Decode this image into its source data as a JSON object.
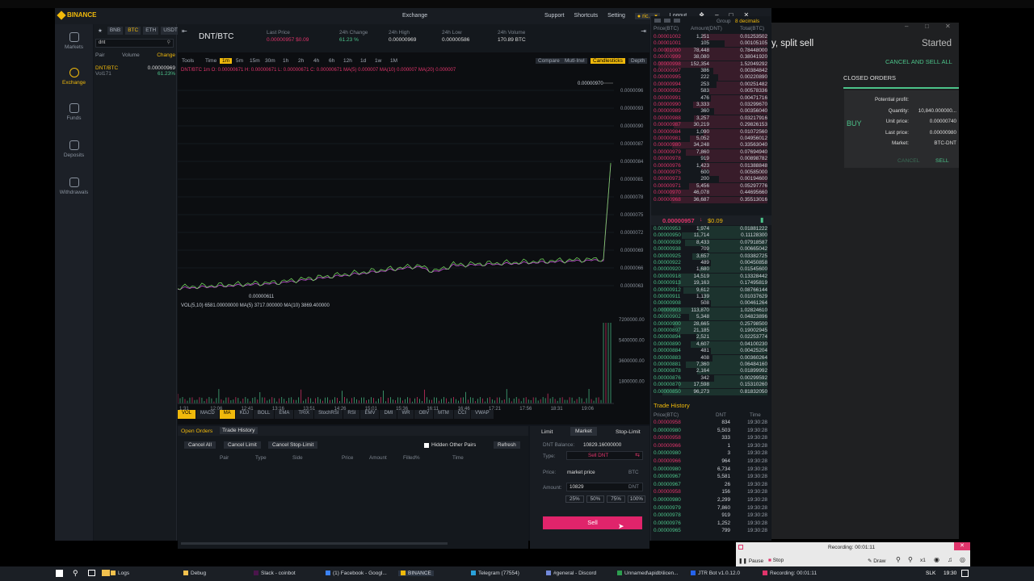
{
  "window": {
    "app_name": "BINANCE",
    "title": "Exchange",
    "nav": [
      "Support",
      "Shortcuts",
      "Setting",
      "ric...",
      "Logout"
    ]
  },
  "sidebar": {
    "items": [
      {
        "label": "Markets",
        "icon": "chart-icon"
      },
      {
        "label": "Exchange",
        "icon": "exchange-icon"
      },
      {
        "label": "Funds",
        "icon": "wallet-icon"
      },
      {
        "label": "Deposits",
        "icon": "download-icon"
      },
      {
        "label": "Withdrawals",
        "icon": "upload-icon"
      }
    ]
  },
  "market_list": {
    "tabs": [
      "BNB",
      "BTC",
      "ETH",
      "USDT"
    ],
    "search_value": "dnt",
    "columns": [
      "Pair",
      "Volume",
      "Change"
    ],
    "row": {
      "pair": "DNT/BTC",
      "vol": "Vol171",
      "price": "0.00000969",
      "change": "61.23%"
    }
  },
  "ticker": {
    "pair": "DNT/BTC",
    "last_price_label": "Last Price",
    "last_price": "0.00000957 $0.09",
    "change_label": "24h Change",
    "change": "61.23 %",
    "high_label": "24h High",
    "high": "0.00000969",
    "low_label": "24h Low",
    "low": "0.00000586",
    "volume_label": "24h Volume",
    "volume": "170.89 BTC"
  },
  "chart_toolbar": {
    "left": [
      "Tools",
      "Time",
      "1m",
      "5m",
      "15m",
      "30m",
      "1h",
      "2h",
      "4h",
      "6h",
      "12h",
      "1d",
      "1w",
      "1M"
    ],
    "right": [
      "Compare",
      "Mutl-Invl",
      "Candlesticks",
      "Depth"
    ],
    "ohlc_text": "DNT/BTC 1m  O: 0.00000671  H: 0.00000671  L: 0.00000671  C: 0.00000671  MA(5) 0.000007  MA(10) 0.000007  MA(20) 0.000007",
    "vol_text": "VOL(5,10)  6581.00000000  MA(5) 3717.000000  MA(10) 3869.400000",
    "max_label": "0.00000970",
    "min_label": "0.00000611",
    "price_axis": [
      "0.0000096",
      "0.0000093",
      "0.0000090",
      "0.0000087",
      "0.0000084",
      "0.0000081",
      "0.0000078",
      "0.0000075",
      "0.0000072",
      "0.0000069",
      "0.0000066",
      "0.0000063"
    ],
    "vol_axis": [
      "7200000.00",
      "5400000.00",
      "3600000.00",
      "1800000.00"
    ],
    "time_axis": [
      "1:31",
      "12:06",
      "12:41",
      "13:16",
      "13:51",
      "14:26",
      "15:01",
      "15:36",
      "16:11",
      "16:46",
      "17:21",
      "17:56",
      "18:31",
      "19:06"
    ],
    "indicators": [
      "VOL",
      "MACD",
      "MA",
      "KDJ",
      "BOLL",
      "EMA",
      "TRIX",
      "StochRSI",
      "RSI",
      "EMV",
      "DMI",
      "WR",
      "OBV",
      "MTM",
      "CCI",
      "VWAP"
    ]
  },
  "orders": {
    "tabs": [
      "Open Orders",
      "Trade History"
    ],
    "buttons": [
      "Cancel All",
      "Cancel Limit",
      "Cancel Stop-Limit"
    ],
    "hidden_label": "Hidden Other Pairs",
    "refresh": "Refresh",
    "columns": [
      "Pair",
      "Type",
      "Side",
      "Price",
      "Amount",
      "Filled%",
      "Time"
    ]
  },
  "trade_form": {
    "tabs": [
      "Limit",
      "Market",
      "Stop-Limit"
    ],
    "balance_label": "DNT Balance:",
    "balance": "10829.16000000",
    "type_label": "Type:",
    "type_value": "Sell DNT",
    "price_label": "Price:",
    "price_value": "market price",
    "price_unit": "BTC",
    "amount_label": "Amount:",
    "amount_value": "10829",
    "amount_unit": "DNT",
    "pct": [
      "25%",
      "50%",
      "75%",
      "100%"
    ],
    "sell": "Sell"
  },
  "order_book": {
    "group_label": "Group",
    "decimals": "8 decimals",
    "cols": [
      "Price(BTC)",
      "Amount(DNT)",
      "Total(BTC)"
    ],
    "asks": [
      [
        "0.00001002",
        "1,251",
        "0.01253502"
      ],
      [
        "0.00001001",
        "105",
        "0.00105105"
      ],
      [
        "0.00001000",
        "78,448",
        "0.78448000"
      ],
      [
        "0.00000999",
        "38,080",
        "0.38041920"
      ],
      [
        "0.00000998",
        "152,354",
        "1.52049292"
      ],
      [
        "0.00000997",
        "386",
        "0.00384842"
      ],
      [
        "0.00000995",
        "222",
        "0.00220890"
      ],
      [
        "0.00000994",
        "253",
        "0.00251482"
      ],
      [
        "0.00000992",
        "583",
        "0.00578336"
      ],
      [
        "0.00000991",
        "476",
        "0.00471716"
      ],
      [
        "0.00000990",
        "3,333",
        "0.03299670"
      ],
      [
        "0.00000989",
        "360",
        "0.00356040"
      ],
      [
        "0.00000988",
        "3,257",
        "0.03217916"
      ],
      [
        "0.00000987",
        "30,219",
        "0.29826153"
      ],
      [
        "0.00000984",
        "1,090",
        "0.01072560"
      ],
      [
        "0.00000981",
        "5,052",
        "0.04956012"
      ],
      [
        "0.00000980",
        "34,248",
        "0.33563040"
      ],
      [
        "0.00000979",
        "7,860",
        "0.07694940"
      ],
      [
        "0.00000978",
        "919",
        "0.00898782"
      ],
      [
        "0.00000976",
        "1,423",
        "0.01388848"
      ],
      [
        "0.00000975",
        "600",
        "0.00585000"
      ],
      [
        "0.00000973",
        "200",
        "0.00194600"
      ],
      [
        "0.00000971",
        "5,456",
        "0.05297776"
      ],
      [
        "0.00000970",
        "46,078",
        "0.44695660"
      ],
      [
        "0.00000968",
        "36,687",
        "0.35513016"
      ]
    ],
    "last": "0.00000957",
    "last_usd": "$0.09",
    "bids": [
      [
        "0.00000953",
        "1,974",
        "0.01881222"
      ],
      [
        "0.00000950",
        "11,714",
        "0.11128300"
      ],
      [
        "0.00000939",
        "8,433",
        "0.07918587"
      ],
      [
        "0.00000938",
        "709",
        "0.00665042"
      ],
      [
        "0.00000925",
        "3,657",
        "0.03382725"
      ],
      [
        "0.00000922",
        "489",
        "0.00450858"
      ],
      [
        "0.00000920",
        "1,680",
        "0.01545600"
      ],
      [
        "0.00000918",
        "14,519",
        "0.13328442"
      ],
      [
        "0.00000913",
        "19,163",
        "0.17495819"
      ],
      [
        "0.00000912",
        "9,612",
        "0.08766144"
      ],
      [
        "0.00000911",
        "1,139",
        "0.01037629"
      ],
      [
        "0.00000908",
        "508",
        "0.00461264"
      ],
      [
        "0.00000903",
        "113,870",
        "1.02824610"
      ],
      [
        "0.00000902",
        "5,348",
        "0.04823896"
      ],
      [
        "0.00000900",
        "28,665",
        "0.25798500"
      ],
      [
        "0.00000897",
        "21,185",
        "0.19002945"
      ],
      [
        "0.00000894",
        "2,521",
        "0.02253774"
      ],
      [
        "0.00000890",
        "4,607",
        "0.04100230"
      ],
      [
        "0.00000884",
        "481",
        "0.00425204"
      ],
      [
        "0.00000883",
        "408",
        "0.00360264"
      ],
      [
        "0.00000881",
        "7,360",
        "0.06484160"
      ],
      [
        "0.00000878",
        "2,164",
        "0.01899992"
      ],
      [
        "0.00000876",
        "342",
        "0.00299592"
      ],
      [
        "0.00000870",
        "17,598",
        "0.15310260"
      ],
      [
        "0.00000850",
        "96,273",
        "0.81832050"
      ]
    ]
  },
  "trade_history": {
    "title": "Trade History",
    "cols": [
      "Price(BTC)",
      "DNT",
      "Time"
    ],
    "rows": [
      [
        "0.00000958",
        "834",
        "19:30:28",
        "s"
      ],
      [
        "0.00000980",
        "5,503",
        "19:30:28",
        "b"
      ],
      [
        "0.00000958",
        "333",
        "19:30:28",
        "s"
      ],
      [
        "0.00000966",
        "1",
        "19:30:28",
        "s"
      ],
      [
        "0.00000980",
        "3",
        "19:30:28",
        "b"
      ],
      [
        "0.00000966",
        "964",
        "19:30:28",
        "s"
      ],
      [
        "0.00000980",
        "6,734",
        "19:30:28",
        "b"
      ],
      [
        "0.00000967",
        "5,581",
        "19:30:28",
        "b"
      ],
      [
        "0.00000967",
        "26",
        "19:30:28",
        "b"
      ],
      [
        "0.00000958",
        "156",
        "19:30:28",
        "s"
      ],
      [
        "0.00000980",
        "2,299",
        "19:30:28",
        "b"
      ],
      [
        "0.00000979",
        "7,860",
        "19:30:28",
        "b"
      ],
      [
        "0.00000978",
        "919",
        "19:30:28",
        "b"
      ],
      [
        "0.00000976",
        "1,252",
        "19:30:28",
        "b"
      ],
      [
        "0.00000965",
        "799",
        "19:30:28",
        "b"
      ]
    ]
  },
  "right_app": {
    "heading": "y, split sell",
    "status": "Started",
    "cancel_sell": "CANCEL AND SELL ALL",
    "closed_orders": "CLOSED ORDERS",
    "buy": "BUY",
    "fields": [
      {
        "label": "Potential profit:",
        "value": ""
      },
      {
        "label": "Quantity:",
        "value": "10,840.000000..."
      },
      {
        "label": "Unit price:",
        "value": "0.00000740"
      },
      {
        "label": "Last price:",
        "value": "0.00000980"
      },
      {
        "label": "Market:",
        "value": "BTC-DNT"
      }
    ],
    "cancel": "CANCEL",
    "sell": "SELL"
  },
  "recorder": {
    "title": "Recording: 00:01:11",
    "pause": "Pause",
    "stop": "Stop",
    "draw": "Draw",
    "zoom": "x1"
  },
  "taskbar": {
    "items": [
      "Logs",
      "Debug",
      "Slack - coinbot",
      "(1) Facebook - Googl...",
      "BINANCE",
      "Telegram (77554)",
      "#general - Discord",
      "Unnamed\\apidb\\licen...",
      "JTR Bot v1.0.12.0",
      "Recording: 00:01:11"
    ],
    "lang": "SLK",
    "time": "19:30"
  },
  "colors": {
    "accent": "#f0b90b",
    "sell": "#e0346b",
    "buy": "#4cc38a",
    "bg": "#12161c"
  }
}
